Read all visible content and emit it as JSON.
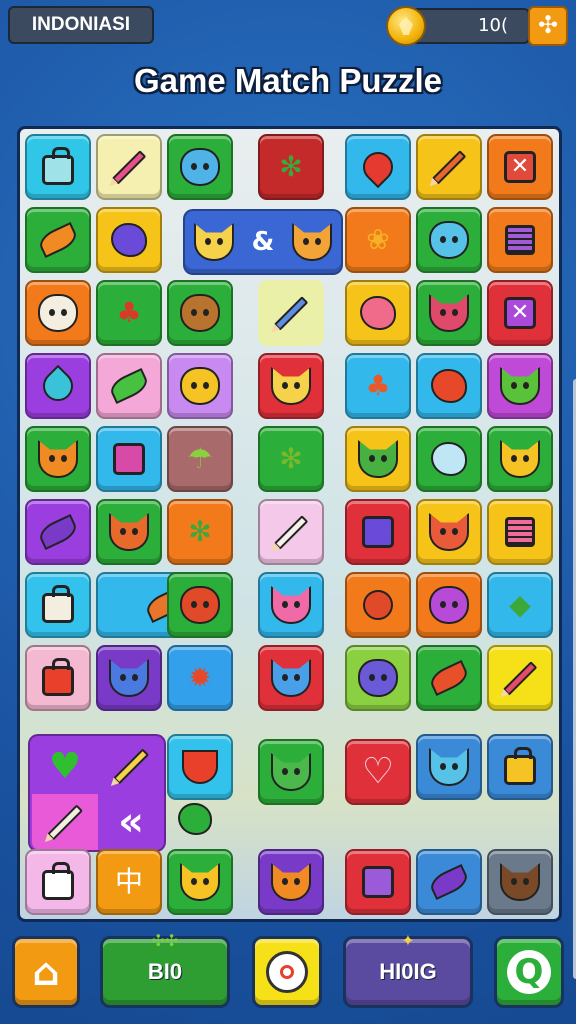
{
  "header": {
    "country_label": "INDONIASI",
    "coins": "10(",
    "plus_label": "✣"
  },
  "title": "Game Match Puzzle",
  "colors": {
    "background": "#1f5fa8",
    "board_border": "#0e2a55",
    "accent_orange": "#f29a12",
    "accent_green": "#2e9e33",
    "accent_purple": "#5a4aa0"
  },
  "board": {
    "wide_tile": {
      "left_icon": "cat-face-icon",
      "middle": "&",
      "right_icon": "cat-face-icon"
    },
    "combo_tile": {
      "icons": [
        "heart-icon",
        "pencil-icon",
        "pencil-icon",
        "rewind-icon"
      ],
      "rewind_glyph": "«"
    },
    "tile_text": [
      "中"
    ]
  },
  "bottom_bar": {
    "home_label": "⌂",
    "left_pill": "BI0",
    "center_icon": "target-icon",
    "right_pill": "HI0IG",
    "refresh_label": "Q"
  }
}
